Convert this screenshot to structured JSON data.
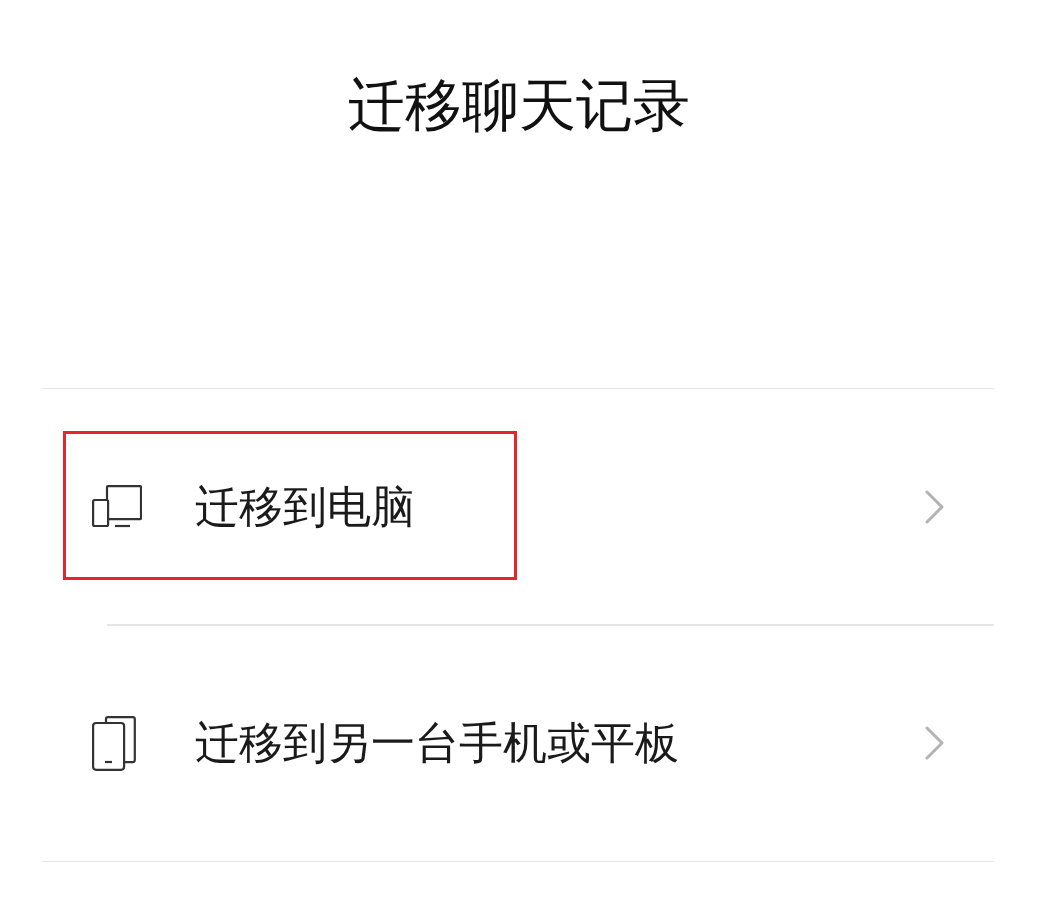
{
  "title": "迁移聊天记录",
  "options": [
    {
      "kind": "computer",
      "label": "迁移到电脑",
      "highlighted": true
    },
    {
      "kind": "phone",
      "label": "迁移到另一台手机或平板",
      "highlighted": false
    }
  ]
}
